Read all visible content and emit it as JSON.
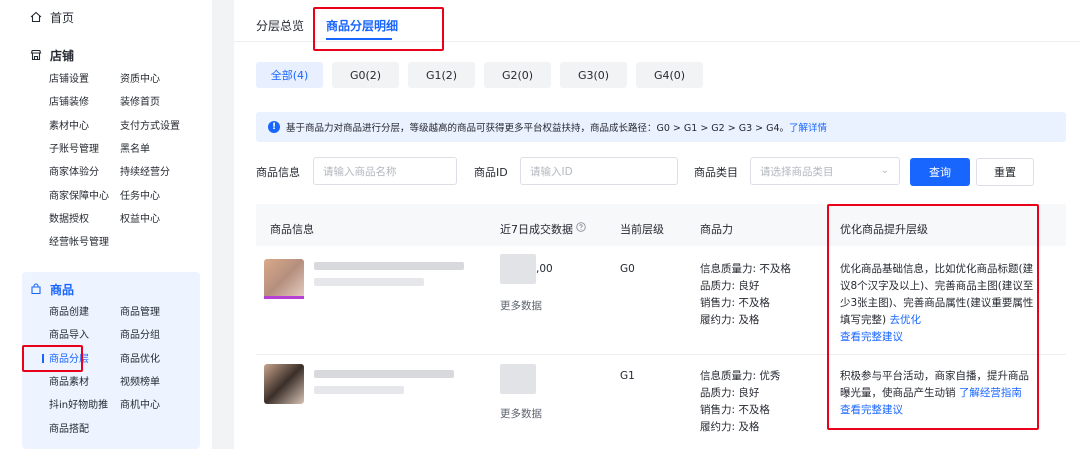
{
  "sidebar": {
    "home": "首页",
    "store": {
      "title": "店铺",
      "items": [
        [
          "店铺设置",
          "资质中心"
        ],
        [
          "店铺装修",
          "装修首页"
        ],
        [
          "素材中心",
          "支付方式设置"
        ],
        [
          "子账号管理",
          "黑名单"
        ],
        [
          "商家体验分",
          "持续经营分"
        ],
        [
          "商家保障中心",
          "任务中心"
        ],
        [
          "数据授权",
          "权益中心"
        ],
        [
          "经营帐号管理",
          ""
        ]
      ]
    },
    "goods": {
      "title": "商品",
      "items": [
        [
          "商品创建",
          "商品管理"
        ],
        [
          "商品导入",
          "商品分组"
        ],
        [
          "商品分层",
          "商品优化"
        ],
        [
          "商品素材",
          "视频榜单"
        ],
        [
          "抖in好物助推",
          "商机中心"
        ],
        [
          "商品搭配",
          ""
        ]
      ],
      "active": "商品分层"
    }
  },
  "tabs": [
    "分层总览",
    "商品分层明细"
  ],
  "active_tab": "商品分层明细",
  "level_filters": [
    "全部(4)",
    "G0(2)",
    "G1(2)",
    "G2(0)",
    "G3(0)",
    "G4(0)"
  ],
  "notice": {
    "text": "基于商品力对商品进行分层，等级越高的商品可获得更多平台权益扶持，商品成长路径：G0 > G1 > G2 > G3 > G4。",
    "link": "了解详情"
  },
  "filters": {
    "info_label": "商品信息",
    "info_placeholder": "请输入商品名称",
    "id_label": "商品ID",
    "id_placeholder": "请输入ID",
    "category_label": "商品类目",
    "category_placeholder": "请选择商品类目",
    "query": "查询",
    "reset": "重置"
  },
  "table": {
    "headers": [
      "商品信息",
      "近7日成交数据",
      "当前层级",
      "商品力",
      "优化商品提升层级"
    ],
    "rows": [
      {
        "sales_value": ",00",
        "more": "更多数据",
        "level": "G0",
        "power": [
          "信息质量力: 不及格",
          "品质力: 良好",
          "销售力: 不及格",
          "履约力: 及格"
        ],
        "advice": "优化商品基础信息，比如优化商品标题(建议8个汉字及以上)、完善商品主图(建议至少3张主图)、完善商品属性(建议重要属性填写完整)",
        "advice_link": "去优化",
        "full_advice": "查看完整建议"
      },
      {
        "sales_value": "",
        "more": "更多数据",
        "level": "G1",
        "power": [
          "信息质量力: 优秀",
          "品质力: 良好",
          "销售力: 不及格",
          "履约力: 及格"
        ],
        "advice": "积极参与平台活动，商家自播，提升商品曝光量，使商品产生动销",
        "advice_link": "了解经营指南",
        "full_advice": "查看完整建议"
      }
    ]
  },
  "colors": {
    "accent": "#1966ff",
    "highlight_box": "#e9001b"
  }
}
